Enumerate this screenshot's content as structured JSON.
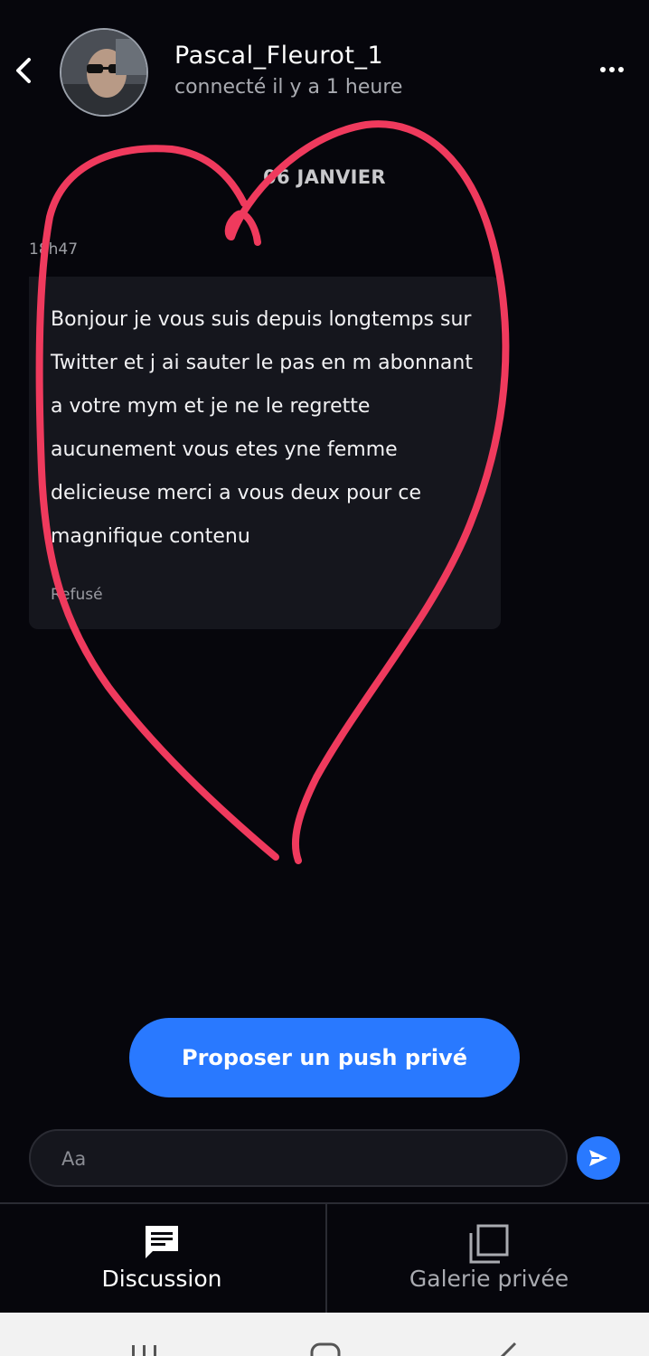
{
  "header": {
    "name": "Pascal_Fleurot_1",
    "presence": "connecté il y a 1 heure"
  },
  "chat": {
    "date_separator": "06 JANVIER",
    "message": {
      "time": "18h47",
      "text": "Bonjour je vous suis depuis longtemps sur Twitter et j ai sauter le pas en m abonnant a votre mym et je ne le regrette aucunement vous etes yne femme delicieuse merci a vous deux pour ce magnifique contenu",
      "status": "Refusé"
    }
  },
  "actions": {
    "push_label": "Proposer un push privé"
  },
  "composer": {
    "placeholder": "Aa"
  },
  "tabs": [
    {
      "label": "Discussion",
      "icon": "chat-icon",
      "active": true
    },
    {
      "label": "Galerie privée",
      "icon": "gallery-icon",
      "active": false
    }
  ],
  "colors": {
    "accent": "#2979ff",
    "background": "#06060c",
    "bubble": "#15161d",
    "annotation": "#ef3a5d"
  }
}
